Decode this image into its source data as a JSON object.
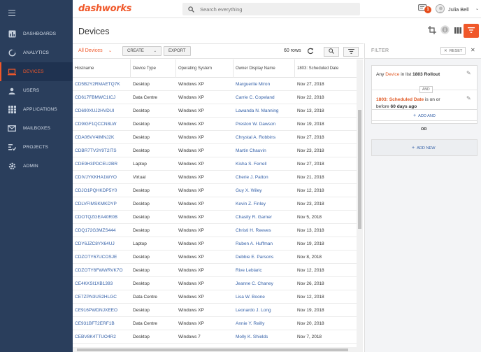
{
  "app": {
    "brand": "dashworks"
  },
  "sidebar": {
    "items": [
      {
        "label": "DASHBOARDS",
        "icon": "dashboard-icon"
      },
      {
        "label": "ANALYTICS",
        "icon": "analytics-icon"
      },
      {
        "label": "DEVICES",
        "icon": "laptop-icon",
        "active": true
      },
      {
        "label": "USERS",
        "icon": "user-icon"
      },
      {
        "label": "APPLICATIONS",
        "icon": "grid-icon"
      },
      {
        "label": "MAILBOXES",
        "icon": "mail-icon"
      },
      {
        "label": "PROJECTS",
        "icon": "projects-icon"
      },
      {
        "label": "ADMIN",
        "icon": "gear-icon"
      }
    ]
  },
  "topbar": {
    "search_placeholder": "Search everything",
    "notifications_count": "1",
    "user_name": "Julia Bell"
  },
  "page": {
    "title": "Devices"
  },
  "toolbar": {
    "list_selector": "All Devices",
    "create_label": "CREATE",
    "export_label": "EXPORT",
    "rows_count": "60 rows"
  },
  "table": {
    "columns": [
      "Hostname",
      "Device Type",
      "Operating System",
      "Owner Display Name",
      "1803: Scheduled Date"
    ],
    "rows": [
      [
        "CD5B2Y2RMAETQ7K",
        "Desktop",
        "Windows XP",
        "Marguerite Miron",
        "Nov 27, 2018"
      ],
      [
        "CD617FBMWC1ICJ",
        "Data Centre",
        "Windows XP",
        "Carrie C. Copeland",
        "Nov 22, 2018"
      ],
      [
        "CD690XUJ2HVDUI",
        "Desktop",
        "Windows XP",
        "Lawanda N. Manning",
        "Nov 13, 2018"
      ],
      [
        "CD9IGF1QCCN8LW",
        "Desktop",
        "Windows XP",
        "Preston W. Dawson",
        "Nov 19, 2018"
      ],
      [
        "CDA06VV4IMNJ2K",
        "Desktop",
        "Windows XP",
        "Chrystal A. Robbins",
        "Nov 27, 2018"
      ],
      [
        "CDBR7TV3Y9T2ITS",
        "Desktop",
        "Windows XP",
        "Martin Chauvin",
        "Nov 23, 2018"
      ],
      [
        "CDE9H3PDCEU2BR",
        "Laptop",
        "Windows XP",
        "Kisha S. Ferrell",
        "Nov 27, 2018"
      ],
      [
        "CDIVJYKKHA1WYO",
        "Virtual",
        "Windows XP",
        "Cherie J. Patton",
        "Nov 21, 2018"
      ],
      [
        "CDJO1PQHKDP5Y0",
        "Desktop",
        "Windows XP",
        "Guy X. Wiley",
        "Nov 12, 2018"
      ],
      [
        "CDLVFIMSKMKDYP",
        "Desktop",
        "Windows XP",
        "Kevin Z. Finley",
        "Nov 23, 2018"
      ],
      [
        "CDOTQZGEA40R0B",
        "Desktop",
        "Windows XP",
        "Chasity R. Garner",
        "Nov 5, 2018"
      ],
      [
        "CDQ172G3MZS444",
        "Desktop",
        "Windows XP",
        "Christi H. Reeves",
        "Nov 13, 2018"
      ],
      [
        "CDY6JZC8YX64UJ",
        "Laptop",
        "Windows XP",
        "Ruben A. Huffman",
        "Nov 19, 2018"
      ],
      [
        "CDZOTY67UCOSJE",
        "Desktop",
        "Windows XP",
        "Debbie E. Parsons",
        "Nov 8, 2018"
      ],
      [
        "CDZOTY6FWWRVK7O",
        "Desktop",
        "Windows XP",
        "Rive Leblaric",
        "Nov 12, 2018"
      ],
      [
        "CE4KKSI1XB1393",
        "Desktop",
        "Windows XP",
        "Jeanne C. Chaney",
        "Nov 26, 2018"
      ],
      [
        "CE7ZPN3US2HLGC",
        "Data Centre",
        "Windows XP",
        "Lisa W. Boone",
        "Nov 12, 2018"
      ],
      [
        "CE916PWDNJXEEO",
        "Desktop",
        "Windows XP",
        "Leonardo J. Long",
        "Nov 19, 2018"
      ],
      [
        "CE931BFT2ERF1B",
        "Data Centre",
        "Windows XP",
        "Annie Y. Reilly",
        "Nov 20, 2018"
      ],
      [
        "CEBV8K4TTUO4R2",
        "Desktop",
        "Windows 7",
        "Molly K. Shields",
        "Nov 7, 2018"
      ]
    ]
  },
  "filter": {
    "title": "FILTER",
    "reset_label": "RESET",
    "criterion1": {
      "pre": "Any ",
      "field": "Device",
      "mid": " in list ",
      "value": "1803 Rollout"
    },
    "and_label": "AND",
    "criterion2": {
      "field": "1803: Scheduled Date",
      "mid": " is on or",
      "line2_pre": "before ",
      "value": "60 days ago"
    },
    "add_and_label": "ADD AND",
    "or_label": "OR",
    "add_new_label": "ADD NEW"
  },
  "colors": {
    "accent": "#f0582a",
    "sidebar": "#2a3e5c",
    "link": "#3561a8"
  }
}
